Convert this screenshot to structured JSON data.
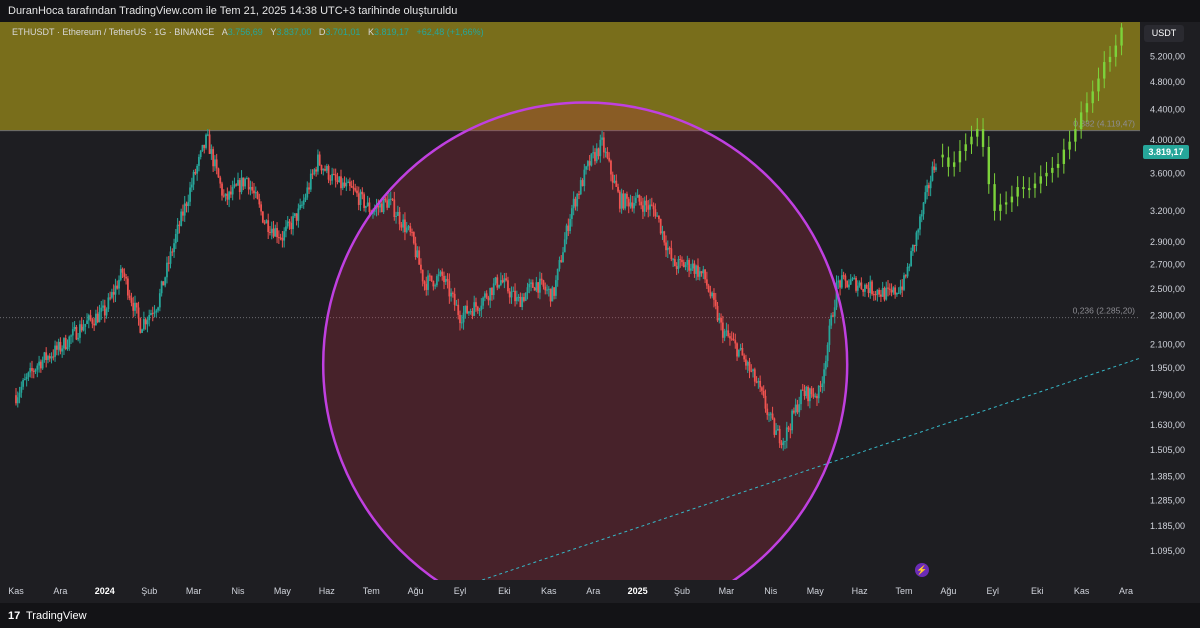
{
  "header": {
    "attribution": "DuranHoca tarafından TradingView.com ile Tem 21, 2025 14:38 UTC+3 tarihinde oluşturuldu"
  },
  "legend": {
    "symbol": "ETHUSDT · Ethereum / TetherUS · 1G · BINANCE",
    "open_label": "A",
    "open": "3.756,69",
    "high_label": "Y",
    "high": "3.837,00",
    "low_label": "D",
    "low": "3.701,01",
    "close_label": "K",
    "close": "3.819,17",
    "change": "+62,48 (+1,66%)"
  },
  "currency": "USDT",
  "last_price": "3.819,17",
  "footer": {
    "brand": "TradingView",
    "logo_glyph": "17"
  },
  "colors": {
    "up": "#26a69a",
    "down": "#ef5350",
    "projection": "#7cd33b",
    "circle": "#c040e0",
    "resistance_zone": "#8a7d1a",
    "trendline": "#36b9c9"
  },
  "chart_data": {
    "type": "candlestick",
    "title": "",
    "scale": "log",
    "grid": false,
    "ylim": [
      1000,
      5800
    ],
    "y_ticks": [
      {
        "v": 5200,
        "label": "5.200,00"
      },
      {
        "v": 4800,
        "label": "4.800,00"
      },
      {
        "v": 4400,
        "label": "4.400,00"
      },
      {
        "v": 4000,
        "label": "4.000,00"
      },
      {
        "v": 3600,
        "label": "3.600,00"
      },
      {
        "v": 3200,
        "label": "3.200,00"
      },
      {
        "v": 2900,
        "label": "2.900,00"
      },
      {
        "v": 2700,
        "label": "2.700,00"
      },
      {
        "v": 2500,
        "label": "2.500,00"
      },
      {
        "v": 2300,
        "label": "2.300,00"
      },
      {
        "v": 2100,
        "label": "2.100,00"
      },
      {
        "v": 1950,
        "label": "1.950,00"
      },
      {
        "v": 1790,
        "label": "1.790,00"
      },
      {
        "v": 1630,
        "label": "1.630,00"
      },
      {
        "v": 1505,
        "label": "1.505,00"
      },
      {
        "v": 1385,
        "label": "1.385,00"
      },
      {
        "v": 1285,
        "label": "1.285,00"
      },
      {
        "v": 1185,
        "label": "1.185,00"
      },
      {
        "v": 1095,
        "label": "1.095,00"
      }
    ],
    "x_ticks": [
      "Kas",
      "Ara",
      "2024",
      "Şub",
      "Mar",
      "Nis",
      "May",
      "Haz",
      "Tem",
      "Ağu",
      "Eyl",
      "Eki",
      "Kas",
      "Ara",
      "2025",
      "Şub",
      "Mar",
      "Nis",
      "May",
      "Haz",
      "Tem",
      "Ağu",
      "Eyl",
      "Eki",
      "Kas",
      "Ara"
    ],
    "x_bold": [
      "2024",
      "2025"
    ],
    "fib_levels": [
      {
        "level": 0.382,
        "price": 4119.47,
        "label": "0,382 (4.119,47)"
      },
      {
        "level": 0.236,
        "price": 2285.2,
        "label": "0,236 (2.285,20)"
      }
    ],
    "resistance_zone": {
      "from": 4119.47,
      "to": 5800
    },
    "trendline": {
      "from": {
        "date": "Eyl 2024",
        "price": 1000
      },
      "to": {
        "date": "Ara 2025",
        "price": 2010
      }
    },
    "anchors": [
      {
        "m": 0,
        "p": 1790
      },
      {
        "m": 0.5,
        "p": 1980
      },
      {
        "m": 1.0,
        "p": 2080
      },
      {
        "m": 1.5,
        "p": 2230
      },
      {
        "m": 2.0,
        "p": 2330
      },
      {
        "m": 2.4,
        "p": 2640
      },
      {
        "m": 2.8,
        "p": 2230
      },
      {
        "m": 3.2,
        "p": 2400
      },
      {
        "m": 3.6,
        "p": 2950
      },
      {
        "m": 4.0,
        "p": 3550
      },
      {
        "m": 4.3,
        "p": 4020
      },
      {
        "m": 4.7,
        "p": 3300
      },
      {
        "m": 5.2,
        "p": 3550
      },
      {
        "m": 5.6,
        "p": 3100
      },
      {
        "m": 6.0,
        "p": 2950
      },
      {
        "m": 6.4,
        "p": 3200
      },
      {
        "m": 6.8,
        "p": 3750
      },
      {
        "m": 7.2,
        "p": 3500
      },
      {
        "m": 7.6,
        "p": 3400
      },
      {
        "m": 8.0,
        "p": 3200
      },
      {
        "m": 8.4,
        "p": 3300
      },
      {
        "m": 8.9,
        "p": 2950
      },
      {
        "m": 9.2,
        "p": 2550
      },
      {
        "m": 9.6,
        "p": 2600
      },
      {
        "m": 10.0,
        "p": 2300
      },
      {
        "m": 10.4,
        "p": 2380
      },
      {
        "m": 10.9,
        "p": 2580
      },
      {
        "m": 11.3,
        "p": 2400
      },
      {
        "m": 11.7,
        "p": 2550
      },
      {
        "m": 12.1,
        "p": 2450
      },
      {
        "m": 12.5,
        "p": 3200
      },
      {
        "m": 12.9,
        "p": 3700
      },
      {
        "m": 13.2,
        "p": 3950
      },
      {
        "m": 13.6,
        "p": 3300
      },
      {
        "m": 14.0,
        "p": 3300
      },
      {
        "m": 14.4,
        "p": 3200
      },
      {
        "m": 14.8,
        "p": 2700
      },
      {
        "m": 15.2,
        "p": 2700
      },
      {
        "m": 15.5,
        "p": 2600
      },
      {
        "m": 15.9,
        "p": 2200
      },
      {
        "m": 16.3,
        "p": 2050
      },
      {
        "m": 16.7,
        "p": 1850
      },
      {
        "m": 17.1,
        "p": 1590
      },
      {
        "m": 17.3,
        "p": 1560
      },
      {
        "m": 17.7,
        "p": 1800
      },
      {
        "m": 18.1,
        "p": 1800
      },
      {
        "m": 18.5,
        "p": 2550
      },
      {
        "m": 18.9,
        "p": 2550
      },
      {
        "m": 19.3,
        "p": 2500
      },
      {
        "m": 19.7,
        "p": 2450
      },
      {
        "m": 20.0,
        "p": 2550
      },
      {
        "m": 20.3,
        "p": 2990
      },
      {
        "m": 20.6,
        "p": 3550
      },
      {
        "m": 20.75,
        "p": 3819
      }
    ],
    "projection": [
      {
        "m": 20.75,
        "p": 3819
      },
      {
        "m": 21.0,
        "p": 3700
      },
      {
        "m": 21.4,
        "p": 3950
      },
      {
        "m": 21.7,
        "p": 4250
      },
      {
        "m": 22.0,
        "p": 3150
      },
      {
        "m": 22.5,
        "p": 3400
      },
      {
        "m": 22.9,
        "p": 3500
      },
      {
        "m": 23.4,
        "p": 3650
      },
      {
        "m": 23.8,
        "p": 4100
      },
      {
        "m": 24.1,
        "p": 4450
      },
      {
        "m": 24.4,
        "p": 4900
      },
      {
        "m": 24.7,
        "p": 5300
      },
      {
        "m": 24.9,
        "p": 5700
      }
    ],
    "circle": {
      "center": {
        "date": "Ara 2024",
        "price": 2100
      },
      "note": "highlighted range"
    }
  }
}
